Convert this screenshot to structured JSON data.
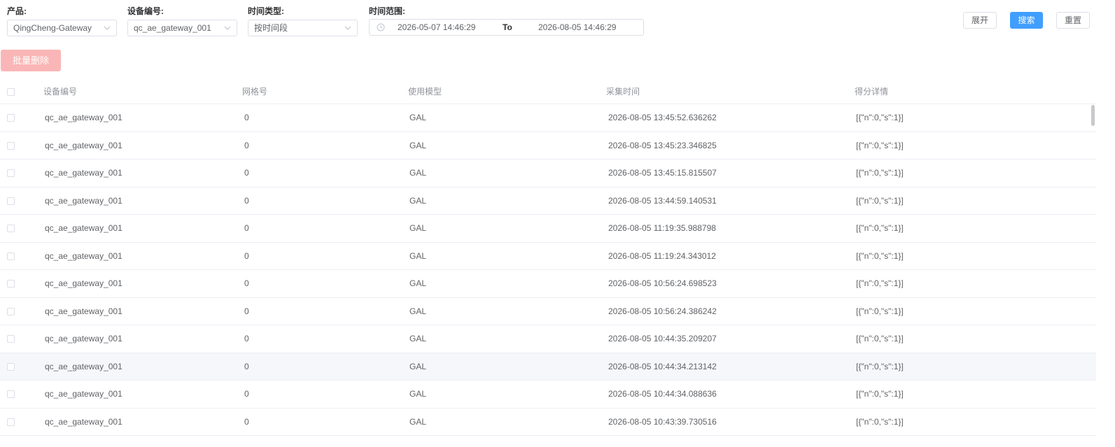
{
  "filters": {
    "product": {
      "label": "产品:",
      "value": "QingCheng-Gateway"
    },
    "device": {
      "label": "设备编号:",
      "value": "qc_ae_gateway_001"
    },
    "time_type": {
      "label": "时间类型:",
      "value": "按时间段"
    },
    "time_range": {
      "label": "时间范围:",
      "start": "2026-05-07 14:46:29",
      "separator": "To",
      "end": "2026-08-05 14:46:29"
    }
  },
  "buttons": {
    "expand": "展开",
    "search": "搜索",
    "reset": "重置",
    "batch_delete": "批量删除"
  },
  "colors": {
    "primary": "#409eff",
    "danger_disabled": "#fab6b6"
  },
  "table": {
    "columns": [
      "设备编号",
      "网格号",
      "使用模型",
      "采集时间",
      "得分详情"
    ],
    "rows": [
      [
        "qc_ae_gateway_001",
        "0",
        "GAL",
        "2026-08-05 13:45:52.636262",
        "[{\"n\":0,\"s\":1}]"
      ],
      [
        "qc_ae_gateway_001",
        "0",
        "GAL",
        "2026-08-05 13:45:23.346825",
        "[{\"n\":0,\"s\":1}]"
      ],
      [
        "qc_ae_gateway_001",
        "0",
        "GAL",
        "2026-08-05 13:45:15.815507",
        "[{\"n\":0,\"s\":1}]"
      ],
      [
        "qc_ae_gateway_001",
        "0",
        "GAL",
        "2026-08-05 13:44:59.140531",
        "[{\"n\":0,\"s\":1}]"
      ],
      [
        "qc_ae_gateway_001",
        "0",
        "GAL",
        "2026-08-05 11:19:35.988798",
        "[{\"n\":0,\"s\":1}]"
      ],
      [
        "qc_ae_gateway_001",
        "0",
        "GAL",
        "2026-08-05 11:19:24.343012",
        "[{\"n\":0,\"s\":1}]"
      ],
      [
        "qc_ae_gateway_001",
        "0",
        "GAL",
        "2026-08-05 10:56:24.698523",
        "[{\"n\":0,\"s\":1}]"
      ],
      [
        "qc_ae_gateway_001",
        "0",
        "GAL",
        "2026-08-05 10:56:24.386242",
        "[{\"n\":0,\"s\":1}]"
      ],
      [
        "qc_ae_gateway_001",
        "0",
        "GAL",
        "2026-08-05 10:44:35.209207",
        "[{\"n\":0,\"s\":1}]"
      ],
      [
        "qc_ae_gateway_001",
        "0",
        "GAL",
        "2026-08-05 10:44:34.213142",
        "[{\"n\":0,\"s\":1}]"
      ],
      [
        "qc_ae_gateway_001",
        "0",
        "GAL",
        "2026-08-05 10:44:34.088636",
        "[{\"n\":0,\"s\":1}]"
      ],
      [
        "qc_ae_gateway_001",
        "0",
        "GAL",
        "2026-08-05 10:43:39.730516",
        "[{\"n\":0,\"s\":1}]"
      ]
    ]
  },
  "icons": {
    "select_arrow": "chevron-down-icon",
    "time_range": "clock-icon"
  }
}
